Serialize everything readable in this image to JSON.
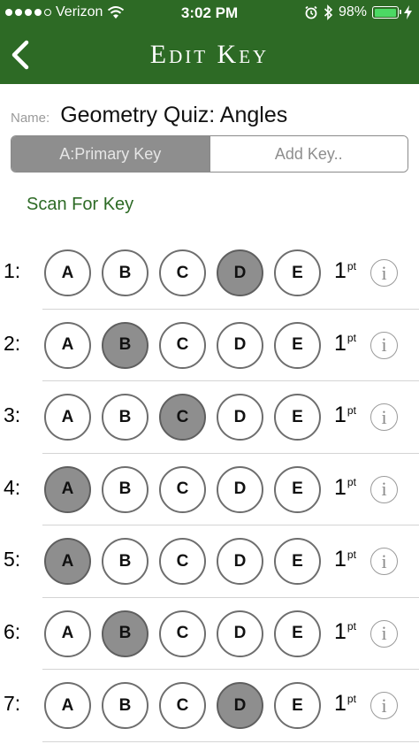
{
  "status_bar": {
    "carrier": "Verizon",
    "time": "3:02 PM",
    "battery": "98%",
    "signal_bars_filled": 4,
    "signal_bars_total": 5,
    "battery_level": 0.98,
    "icons": [
      "wifi-icon",
      "alarm-icon",
      "bluetooth-icon",
      "battery-icon",
      "charging-icon"
    ]
  },
  "nav": {
    "title": "Edit Key",
    "back_icon": "chevron-left-icon"
  },
  "form": {
    "name_label": "Name:",
    "name_value": "Geometry Quiz: Angles"
  },
  "segments": [
    {
      "label": "A:Primary Key",
      "active": true
    },
    {
      "label": "Add Key..",
      "active": false
    }
  ],
  "scan_label": "Scan For Key",
  "choices": [
    "A",
    "B",
    "C",
    "D",
    "E"
  ],
  "questions": [
    {
      "number": "1:",
      "answer": "D",
      "points": "1",
      "unit": "pt"
    },
    {
      "number": "2:",
      "answer": "B",
      "points": "1",
      "unit": "pt"
    },
    {
      "number": "3:",
      "answer": "C",
      "points": "1",
      "unit": "pt"
    },
    {
      "number": "4:",
      "answer": "A",
      "points": "1",
      "unit": "pt"
    },
    {
      "number": "5:",
      "answer": "A",
      "points": "1",
      "unit": "pt"
    },
    {
      "number": "6:",
      "answer": "B",
      "points": "1",
      "unit": "pt"
    },
    {
      "number": "7:",
      "answer": "D",
      "points": "1",
      "unit": "pt"
    }
  ],
  "info_symbol": "i",
  "colors": {
    "brand_green": "#2d6a25",
    "selected_bubble": "#8e8e8e",
    "battery_green": "#4cd964"
  }
}
